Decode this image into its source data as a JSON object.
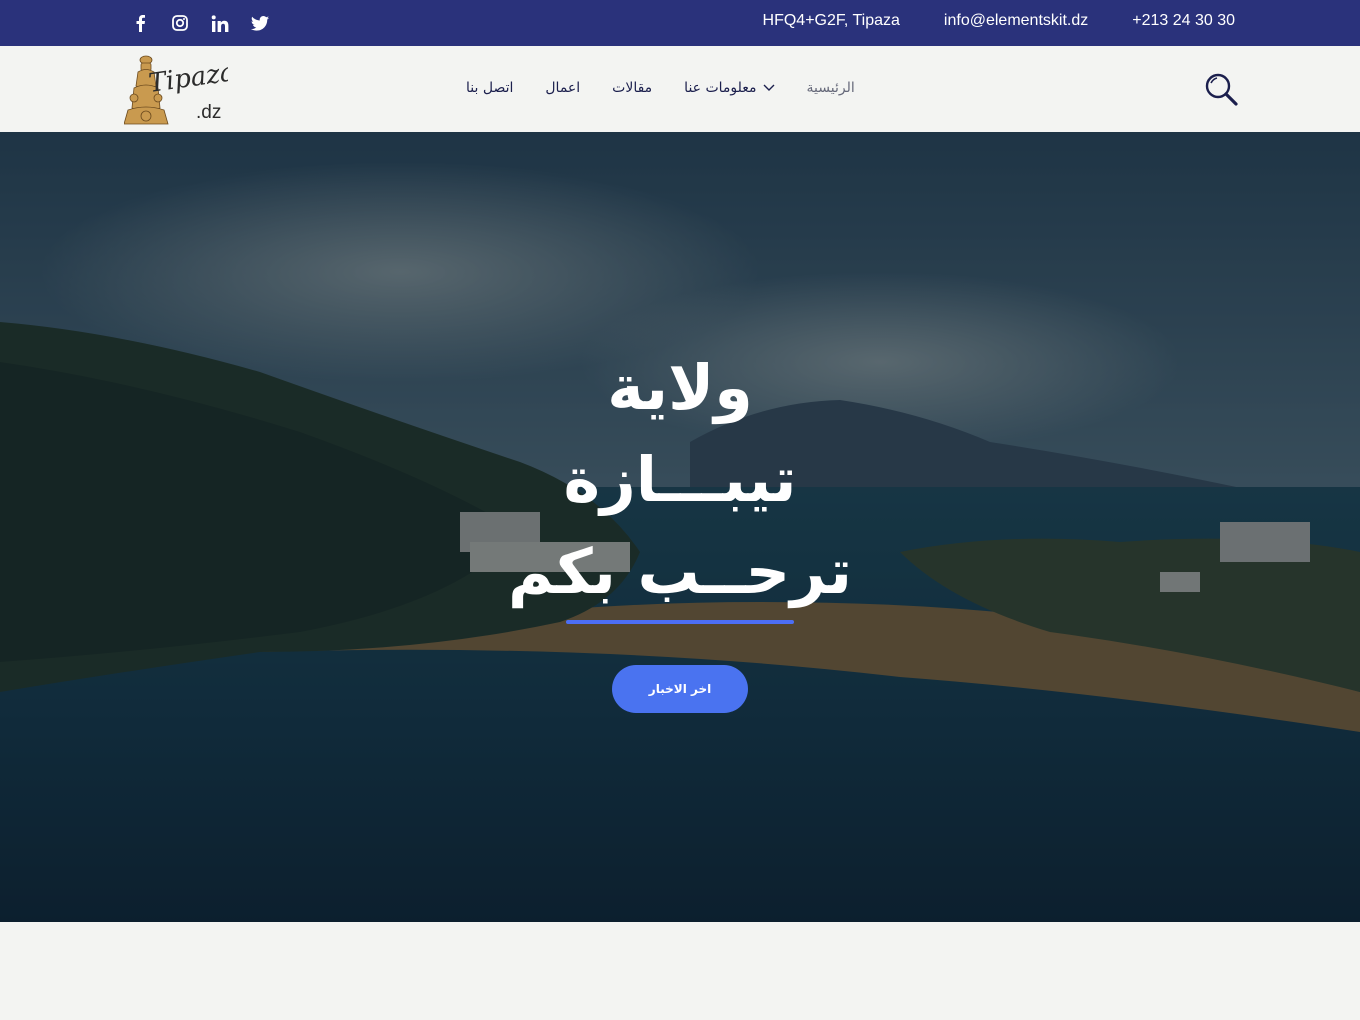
{
  "topbar": {
    "social_icons": [
      "facebook-icon",
      "instagram-icon",
      "linkedin-icon",
      "twitter-icon"
    ],
    "address": "HFQ4+G2F, Tipaza",
    "email": "info@elementskit.dz",
    "phone": "+213 24 30 30"
  },
  "header": {
    "logo_text": "Tipaza",
    "logo_suffix": ".dz",
    "menu": [
      {
        "label": "الرئيسية",
        "active": true
      },
      {
        "label": "معلومات عنا",
        "has_dropdown": true
      },
      {
        "label": "مقالات"
      },
      {
        "label": "اعمال"
      },
      {
        "label": "اتصل بنا"
      }
    ],
    "search_icon": "search-icon"
  },
  "hero": {
    "line1": "ولاية",
    "line2": "تيبـــازة",
    "line3": "ترحــب بكم",
    "cta_label": "اخر الاخبار"
  },
  "colors": {
    "topbar_bg": "#2a327b",
    "nav_bg": "#f3f4f2",
    "accent": "#4a73f0",
    "menu_text": "#1b1f4d"
  }
}
